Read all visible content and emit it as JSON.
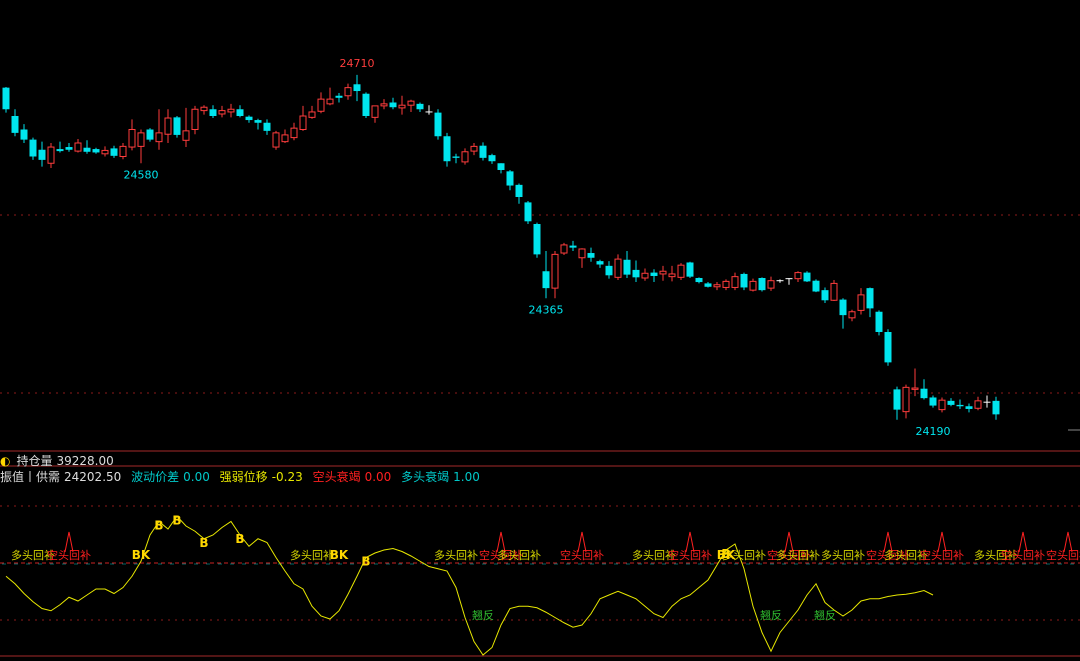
{
  "info": {
    "open_interest_label": "持仓量",
    "open_interest_value": "39228.00",
    "amplitude_label": "振值丨供需",
    "amplitude_value": "24202.50",
    "volatility_label": "波动价差",
    "volatility_value": "0.00",
    "strength_label": "强弱位移",
    "strength_value": "-0.23",
    "short_exhaust_label": "空头衰竭",
    "short_exhaust_value": "0.00",
    "long_exhaust_label": "多头衰竭",
    "long_exhaust_value": "1.00"
  },
  "colors": {
    "up": "#ff3d3d",
    "down": "#00e5ee",
    "indicator": "#e8e800",
    "signal_yellow": "#ffd700",
    "long_text": "#d8d800",
    "short_text": "#ff2020",
    "green_text": "#30c030",
    "grid": "#8b1a1a",
    "oi_label": "#dddddd",
    "volatility": "#00c8c8",
    "strength": "#e8e800",
    "short_exhaust": "#ff2020",
    "long_exhaust": "#00c8c8"
  },
  "chart_data": [
    {
      "type": "candlestick",
      "y_range": [
        24170,
        24730
      ],
      "ohlc": [
        [
          24692,
          24693,
          24655,
          24660
        ],
        [
          24650,
          24660,
          24620,
          24625
        ],
        [
          24630,
          24638,
          24610,
          24615
        ],
        [
          24615,
          24618,
          24585,
          24590
        ],
        [
          24600,
          24612,
          24575,
          24585
        ],
        [
          24580,
          24610,
          24573,
          24604
        ],
        [
          24601,
          24612,
          24596,
          24598
        ],
        [
          24604,
          24610,
          24597,
          24600
        ],
        [
          24598,
          24616,
          24596,
          24610
        ],
        [
          24603,
          24614,
          24594,
          24597
        ],
        [
          24601,
          24603,
          24594,
          24596
        ],
        [
          24594,
          24605,
          24590,
          24599
        ],
        [
          24602,
          24606,
          24588,
          24591
        ],
        [
          24590,
          24610,
          24586,
          24605
        ],
        [
          24604,
          24645,
          24599,
          24630
        ],
        [
          24605,
          24630,
          24580,
          24625
        ],
        [
          24630,
          24632,
          24612,
          24615
        ],
        [
          24612,
          24660,
          24600,
          24625
        ],
        [
          24623,
          24660,
          24610,
          24647
        ],
        [
          24648,
          24650,
          24618,
          24622
        ],
        [
          24614,
          24662,
          24604,
          24628
        ],
        [
          24630,
          24665,
          24623,
          24660
        ],
        [
          24658,
          24666,
          24652,
          24663
        ],
        [
          24660,
          24666,
          24647,
          24650
        ],
        [
          24653,
          24665,
          24648,
          24658
        ],
        [
          24656,
          24668,
          24648,
          24660
        ],
        [
          24660,
          24666,
          24648,
          24650
        ],
        [
          24649,
          24651,
          24640,
          24644
        ],
        [
          24644,
          24646,
          24630,
          24640
        ],
        [
          24640,
          24645,
          24622,
          24628
        ],
        [
          24604,
          24628,
          24600,
          24625
        ],
        [
          24612,
          24630,
          24610,
          24622
        ],
        [
          24618,
          24640,
          24614,
          24632
        ],
        [
          24630,
          24665,
          24628,
          24650
        ],
        [
          24648,
          24665,
          24646,
          24656
        ],
        [
          24657,
          24685,
          24654,
          24675
        ],
        [
          24668,
          24692,
          24666,
          24675
        ],
        [
          24680,
          24684,
          24670,
          24677
        ],
        [
          24680,
          24698,
          24674,
          24692
        ],
        [
          24697,
          24711,
          24672,
          24687
        ],
        [
          24683,
          24685,
          24647,
          24650
        ],
        [
          24648,
          24660,
          24640,
          24665
        ],
        [
          24665,
          24675,
          24660,
          24668
        ],
        [
          24670,
          24677,
          24660,
          24663
        ],
        [
          24662,
          24680,
          24652,
          24666
        ],
        [
          24666,
          24674,
          24656,
          24672
        ],
        [
          24668,
          24670,
          24656,
          24660
        ],
        [
          24655,
          24666,
          24652,
          24656
        ],
        [
          24655,
          24660,
          24615,
          24620
        ],
        [
          24620,
          24625,
          24575,
          24583
        ],
        [
          24590,
          24594,
          24580,
          24588
        ],
        [
          24582,
          24602,
          24578,
          24597
        ],
        [
          24598,
          24610,
          24592,
          24605
        ],
        [
          24606,
          24611,
          24584,
          24588
        ],
        [
          24592,
          24594,
          24579,
          24583
        ],
        [
          24580,
          24580,
          24565,
          24570
        ],
        [
          24568,
          24570,
          24540,
          24547
        ],
        [
          24548,
          24550,
          24520,
          24530
        ],
        [
          24522,
          24524,
          24490,
          24494
        ],
        [
          24490,
          24492,
          24440,
          24445
        ],
        [
          24420,
          24450,
          24380,
          24395
        ],
        [
          24395,
          24450,
          24380,
          24445
        ],
        [
          24447,
          24462,
          24444,
          24459
        ],
        [
          24458,
          24465,
          24450,
          24455
        ],
        [
          24440,
          24454,
          24425,
          24453
        ],
        [
          24447,
          24455,
          24434,
          24440
        ],
        [
          24435,
          24437,
          24425,
          24430
        ],
        [
          24428,
          24435,
          24409,
          24414
        ],
        [
          24411,
          24445,
          24407,
          24438
        ],
        [
          24437,
          24450,
          24410,
          24415
        ],
        [
          24422,
          24436,
          24404,
          24411
        ],
        [
          24410,
          24424,
          24406,
          24417
        ],
        [
          24418,
          24423,
          24404,
          24413
        ],
        [
          24416,
          24428,
          24406,
          24420
        ],
        [
          24412,
          24428,
          24405,
          24416
        ],
        [
          24411,
          24432,
          24407,
          24429
        ],
        [
          24433,
          24434,
          24410,
          24412
        ],
        [
          24410,
          24411,
          24402,
          24404
        ],
        [
          24402,
          24404,
          24396,
          24397
        ],
        [
          24397,
          24404,
          24392,
          24400
        ],
        [
          24396,
          24408,
          24392,
          24405
        ],
        [
          24396,
          24418,
          24392,
          24412
        ],
        [
          24416,
          24418,
          24392,
          24396
        ],
        [
          24392,
          24409,
          24390,
          24405
        ],
        [
          24410,
          24411,
          24390,
          24392
        ],
        [
          24395,
          24412,
          24391,
          24406
        ],
        [
          24405,
          24408,
          24403,
          24406
        ],
        [
          24408,
          24410,
          24400,
          24409
        ],
        [
          24409,
          24420,
          24404,
          24418
        ],
        [
          24418,
          24420,
          24404,
          24405
        ],
        [
          24406,
          24408,
          24389,
          24390
        ],
        [
          24392,
          24396,
          24373,
          24377
        ],
        [
          24377,
          24407,
          24376,
          24402
        ],
        [
          24378,
          24380,
          24335,
          24355
        ],
        [
          24351,
          24363,
          24346,
          24360
        ],
        [
          24362,
          24395,
          24356,
          24385
        ],
        [
          24395,
          24396,
          24352,
          24365
        ],
        [
          24360,
          24362,
          24325,
          24330
        ],
        [
          24330,
          24334,
          24280,
          24285
        ],
        [
          24245,
          24249,
          24200,
          24215
        ],
        [
          24212,
          24252,
          24202,
          24248
        ],
        [
          24245,
          24276,
          24235,
          24247
        ],
        [
          24246,
          24260,
          24230,
          24232
        ],
        [
          24233,
          24236,
          24218,
          24221
        ],
        [
          24215,
          24233,
          24211,
          24229
        ],
        [
          24228,
          24232,
          24220,
          24222
        ],
        [
          24222,
          24230,
          24216,
          24220
        ],
        [
          24220,
          24224,
          24211,
          24216
        ],
        [
          24217,
          24234,
          24214,
          24228
        ],
        [
          24226,
          24236,
          24218,
          24226
        ],
        [
          24228,
          24234,
          24200,
          24208
        ]
      ],
      "annotations": [
        {
          "label": "24710",
          "price": 24711,
          "bar": 39,
          "kind": "high"
        },
        {
          "label": "24580",
          "price": 24580,
          "bar": 15,
          "kind": "low"
        },
        {
          "label": "24365",
          "price": 24380,
          "bar": 60,
          "kind": "low"
        },
        {
          "label": "24190",
          "price": 24200,
          "bar": 103,
          "kind": "low"
        }
      ]
    },
    {
      "type": "line",
      "y_range": [
        -100,
        100
      ],
      "values": [
        5,
        -5,
        -18,
        -29,
        -38,
        -41,
        -33,
        -23,
        -28,
        -20,
        -12,
        -12,
        -18,
        -10,
        5,
        25,
        60,
        78,
        68,
        85,
        72,
        65,
        55,
        60,
        70,
        78,
        60,
        45,
        55,
        50,
        30,
        12,
        -5,
        -12,
        -35,
        -48,
        -52,
        -41,
        -19,
        5,
        30,
        36,
        40,
        42,
        38,
        32,
        25,
        18,
        15,
        12,
        -10,
        -50,
        -82,
        -100,
        -90,
        -60,
        -38,
        -35,
        -35,
        -37,
        -43,
        -50,
        -57,
        -63,
        -60,
        -45,
        -25,
        -20,
        -15,
        -20,
        -25,
        -35,
        -45,
        -50,
        -35,
        -25,
        -20,
        -10,
        0,
        20,
        40,
        48,
        15,
        -35,
        -70,
        -95,
        -70,
        -55,
        -40,
        -20,
        -5,
        -30,
        -40,
        -48,
        -40,
        -28,
        -25,
        -25,
        -22,
        -20,
        -19,
        -17,
        -14,
        -20
      ],
      "reference_levels": [
        0,
        -63
      ]
    }
  ],
  "signals": [
    {
      "text": "B",
      "bar": 17,
      "color_key": "signal_yellow",
      "value": 78
    },
    {
      "text": "B",
      "bar": 19,
      "color_key": "signal_yellow",
      "value": 85
    },
    {
      "text": "B",
      "bar": 22,
      "color_key": "signal_yellow",
      "value": 55
    },
    {
      "text": "B",
      "bar": 26,
      "color_key": "signal_yellow",
      "value": 60
    },
    {
      "text": "B",
      "bar": 40,
      "color_key": "signal_yellow",
      "value": 30
    },
    {
      "text": "B",
      "bar": 80,
      "color_key": "signal_yellow",
      "value": 40
    },
    {
      "text": "BK",
      "bar": 15,
      "color_key": "signal_yellow",
      "value": 25
    },
    {
      "text": "BK",
      "bar": 37,
      "color_key": "signal_yellow",
      "value": -41
    },
    {
      "text": "BK",
      "bar": 80,
      "color_key": "signal_yellow",
      "value": 40
    }
  ],
  "labels": [
    {
      "text": "多头回补",
      "bar": 3,
      "color_key": "long_text"
    },
    {
      "text": "空头回补",
      "bar": 7,
      "color_key": "short_text"
    },
    {
      "text": "多头回补",
      "bar": 34,
      "color_key": "long_text"
    },
    {
      "text": "多头回补",
      "bar": 50,
      "color_key": "long_text"
    },
    {
      "text": "空头回补",
      "bar": 55,
      "color_key": "short_text"
    },
    {
      "text": "多头回补",
      "bar": 57,
      "color_key": "long_text"
    },
    {
      "text": "空头回补",
      "bar": 64,
      "color_key": "short_text"
    },
    {
      "text": "多头回补",
      "bar": 72,
      "color_key": "long_text"
    },
    {
      "text": "空头回补",
      "bar": 76,
      "color_key": "short_text"
    },
    {
      "text": "多头回补",
      "bar": 82,
      "color_key": "long_text"
    },
    {
      "text": "空头回补",
      "bar": 87,
      "color_key": "short_text"
    },
    {
      "text": "多头回补",
      "bar": 88,
      "color_key": "long_text"
    },
    {
      "text": "多头回补",
      "bar": 93,
      "color_key": "long_text"
    },
    {
      "text": "空头回补",
      "bar": 98,
      "color_key": "short_text"
    },
    {
      "text": "多头回补",
      "bar": 100,
      "color_key": "long_text"
    },
    {
      "text": "空头回补",
      "bar": 104,
      "color_key": "short_text"
    },
    {
      "text": "多头回补",
      "bar": 110,
      "color_key": "long_text"
    },
    {
      "text": "空头回补",
      "bar": 113,
      "color_key": "short_text"
    },
    {
      "text": "空头回补",
      "bar": 118,
      "color_key": "short_text"
    }
  ],
  "lows": [
    {
      "text": "翘反",
      "bar": 53,
      "color_key": "green_text"
    },
    {
      "text": "翘反",
      "bar": 85,
      "color_key": "green_text"
    },
    {
      "text": "翘反",
      "bar": 91,
      "color_key": "green_text"
    }
  ]
}
